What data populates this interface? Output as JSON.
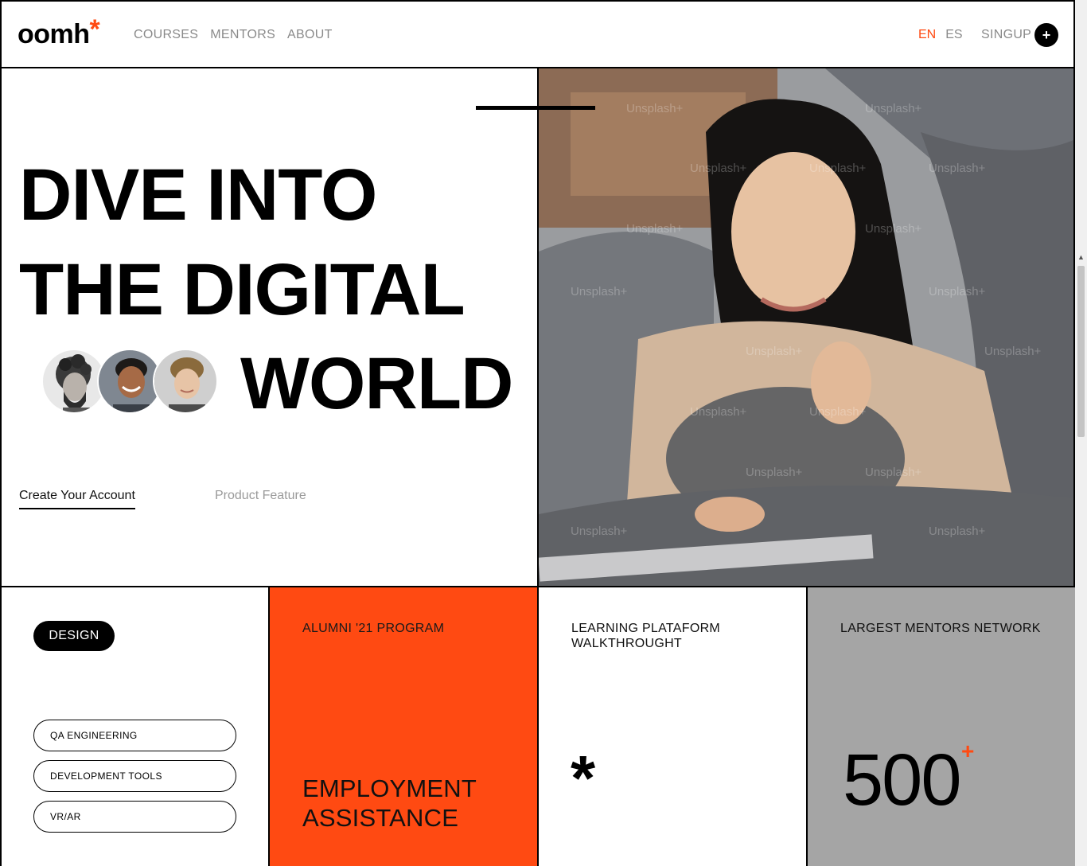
{
  "header": {
    "logo_text": "oomh",
    "logo_mark": "*",
    "nav": [
      "COURSES",
      "MENTORS",
      "ABOUT"
    ],
    "lang_active": "EN",
    "lang_other": "ES",
    "signup_label": "SINGUP",
    "signup_icon": "+"
  },
  "hero": {
    "line1": "DIVE INTO",
    "line2": "THE DIGITAL",
    "line3": "WORLD",
    "cta_primary": "Create Your Account",
    "cta_secondary": "Product Feature",
    "avatars": [
      "mentor-avatar-1",
      "mentor-avatar-2",
      "mentor-avatar-3"
    ],
    "image_watermark": "Unsplash+"
  },
  "cards": {
    "design_tag": "DESIGN",
    "categories": [
      "QA ENGINEERING",
      "DEVELOPMENT TOOLS",
      "VR/AR"
    ],
    "alumni_label": "ALUMNI '21 PROGRAM",
    "employment_line1": "EMPLOYMENT",
    "employment_line2": "ASSISTANCE",
    "walkthrough_line1": "LEARNING PLATAFORM",
    "walkthrough_line2": "WALKTHROUGHT",
    "walkthrough_mark": "*",
    "mentors_label": "LARGEST MENTORS NETWORK",
    "mentors_count": "500",
    "mentors_plus": "+"
  },
  "colors": {
    "accent": "#ff4a12",
    "card_gray": "#a5a5a5",
    "muted_text": "#8a8a8a"
  }
}
